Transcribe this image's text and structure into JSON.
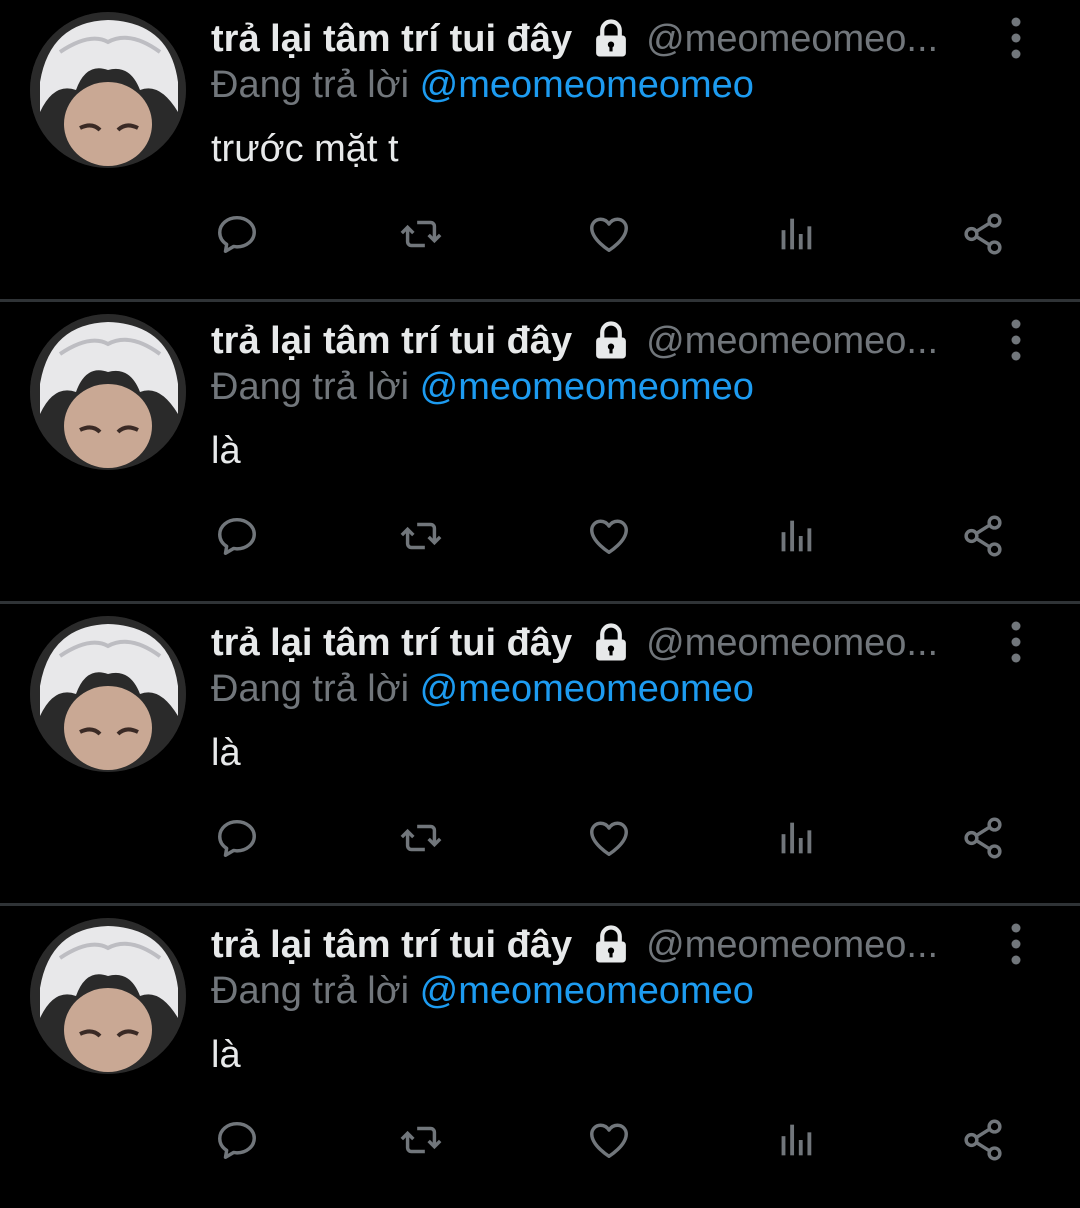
{
  "tweets": [
    {
      "display_name": "trả lại tâm trí tui đây",
      "handle": "@meomeomeo...",
      "reply_prefix": "Đang trả lời",
      "reply_to": "@meomeomeomeo",
      "text": "trước mặt t",
      "icons": {
        "lock": "lock-icon",
        "more": "more-vertical-icon"
      }
    },
    {
      "display_name": "trả lại tâm trí tui đây",
      "handle": "@meomeomeo...",
      "reply_prefix": "Đang trả lời",
      "reply_to": "@meomeomeomeo",
      "text": "là",
      "icons": {
        "lock": "lock-icon",
        "more": "more-vertical-icon"
      }
    },
    {
      "display_name": "trả lại tâm trí tui đây",
      "handle": "@meomeomeo...",
      "reply_prefix": "Đang trả lời",
      "reply_to": "@meomeomeomeo",
      "text": "là",
      "icons": {
        "lock": "lock-icon",
        "more": "more-vertical-icon"
      }
    },
    {
      "display_name": "trả lại tâm trí tui đây",
      "handle": "@meomeomeo...",
      "reply_prefix": "Đang trả lời",
      "reply_to": "@meomeomeomeo",
      "text": "là",
      "icons": {
        "lock": "lock-icon",
        "more": "more-vertical-icon"
      }
    }
  ],
  "action_icons": [
    "reply-icon",
    "retweet-icon",
    "like-icon",
    "views-icon",
    "share-icon"
  ],
  "colors": {
    "background": "#000000",
    "primary_text": "#e7e9ea",
    "secondary_text": "#71767b",
    "link": "#1d9bf0",
    "divider": "#2f3336"
  }
}
